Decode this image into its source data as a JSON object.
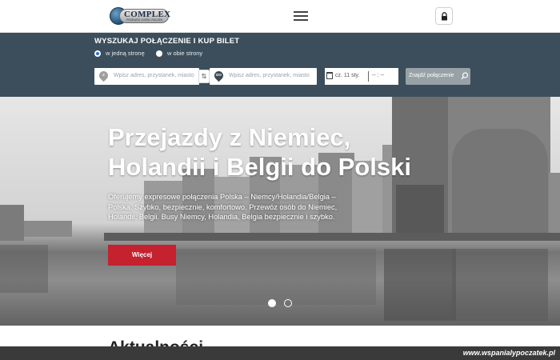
{
  "header": {
    "logo": {
      "brand": "COMPLEX",
      "tagline": "PRZEWÓZ OSÓB I PACZEK"
    },
    "menu_icon": "hamburger-icon",
    "account_icon": "lock-icon"
  },
  "search": {
    "title": "WYSZUKAJ POŁĄCZENIE I KUP BILET",
    "trip_types": [
      {
        "label": "w jedną stronę",
        "selected": true
      },
      {
        "label": "w obie strony",
        "selected": false
      }
    ],
    "from": {
      "badge": "Z",
      "placeholder": "Wpisz adres, przystanek, miasto"
    },
    "to": {
      "badge": "DO",
      "placeholder": "Wpisz adres, przystanek, miasto"
    },
    "swap_icon": "swap-arrows-icon",
    "date": "cz. 11 sty.",
    "time": "-- : --",
    "find_button": "Znajdź połączenie",
    "find_icon": "search-icon"
  },
  "hero": {
    "title": "Przejazdy z Niemiec, Holandii i Belgii do Polski",
    "description": "Oferujemy expresowe połączenia Polska – Niemcy/Holandia/Belgia – Polska. Szybko, bezpiecznie, komfortowo. Przewóz osób do Niemiec, Holandii, Belgii. Busy Niemcy, Holandia, Belgia bezpiecznie i szybko.",
    "button": "Więcej",
    "slides": [
      {
        "active": true
      },
      {
        "active": false
      }
    ]
  },
  "sections": {
    "news_title": "Aktualności"
  },
  "watermark": "www.wspanialypoczatek.pl",
  "colors": {
    "search_panel": "#3c4e5b",
    "accent_red": "#c5212e",
    "find_button": "#98a1a6",
    "from_pin": "#9e9e9e",
    "to_pin": "#3d4a54"
  }
}
